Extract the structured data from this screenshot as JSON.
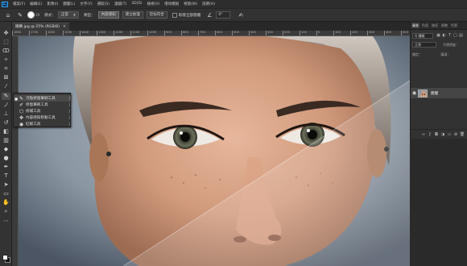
{
  "menubar": {
    "logo": "Ps",
    "items": [
      "檔案(F)",
      "編輯(E)",
      "影像(I)",
      "圖層(L)",
      "文字(Y)",
      "選取(S)",
      "濾鏡(T)",
      "3D(D)",
      "檢視(V)",
      "增效模組",
      "視窗(W)",
      "說明(H)"
    ]
  },
  "options": {
    "brush_size": "19",
    "mode_label": "模式：",
    "mode_value": "正常",
    "source_label": "類型：",
    "btn_content_aware": "內容感知",
    "btn_create_texture": "建立紋理",
    "btn_proximity": "近似符合",
    "sample_all_label": "取樣全部圖層",
    "angle_value": "0°"
  },
  "document": {
    "tab_title": "眼睛.jpg @ 25% (RGB/8)",
    "close_glyph": "×",
    "ruler_ticks": [
      "1800",
      "1700",
      "1600",
      "1500",
      "1400",
      "1300",
      "1200",
      "1100",
      "1000",
      "900",
      "800",
      "700",
      "600",
      "500",
      "400",
      "300",
      "200",
      "100",
      "0",
      "100",
      "200",
      "300",
      "400",
      "500"
    ]
  },
  "tool_flyout": {
    "items": [
      {
        "label": "污點修復筆刷工具",
        "key": "J",
        "icon": "spot-healing-icon",
        "glyph": "✎",
        "selected": true
      },
      {
        "label": "修復筆刷工具",
        "key": "J",
        "icon": "healing-brush-icon",
        "glyph": "✐",
        "selected": false
      },
      {
        "label": "修補工具",
        "key": "J",
        "icon": "patch-icon",
        "glyph": "⬡",
        "selected": false
      },
      {
        "label": "內容感知移動工具",
        "key": "J",
        "icon": "content-aware-move-icon",
        "glyph": "✥",
        "selected": false
      },
      {
        "label": "紅眼工具",
        "key": "J",
        "icon": "red-eye-icon",
        "glyph": "◉",
        "selected": false
      }
    ]
  },
  "layers_panel": {
    "tabs": [
      "圖層",
      "色版",
      "路徑",
      "調整",
      "色票"
    ],
    "filter_value": "Q 種類",
    "blend_value": "正常",
    "opacity_label": "不透明度：",
    "lock_label": "鎖定：",
    "fill_label": "填滿：",
    "layer_name": "圖層"
  },
  "colors": {
    "accent": "#31a8ff",
    "panel_bg": "#323232",
    "fg_swatch": "#ffffff",
    "bg_swatch": "#111111"
  }
}
